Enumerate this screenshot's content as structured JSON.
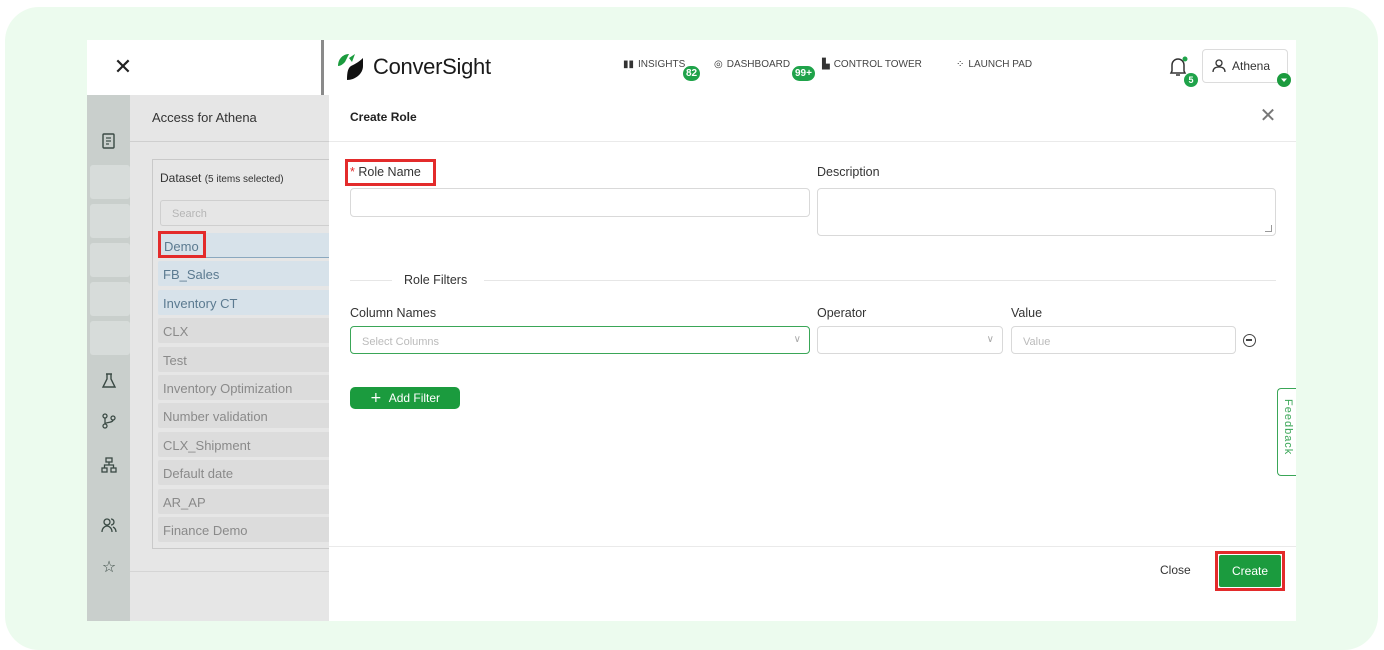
{
  "app": {
    "brand": "ConverSight",
    "brand_color": "#1b9b3e",
    "highlight_color": "#e32b2b"
  },
  "nav": {
    "items": [
      {
        "label": "INSIGHTS",
        "icon": "bar-chart-icon",
        "badge": "82"
      },
      {
        "label": "DASHBOARD",
        "icon": "dashboard-icon",
        "badge": "99+"
      },
      {
        "label": "CONTROL TOWER",
        "icon": "control-tower-icon",
        "badge": ""
      },
      {
        "label": "LAUNCH PAD",
        "icon": "launch-pad-icon",
        "badge": ""
      }
    ],
    "notifications_badge": "5",
    "user": "Athena"
  },
  "access_panel": {
    "title": "Access for Athena",
    "dataset_label": "Dataset",
    "dataset_count": "(5 items selected)",
    "search_placeholder": "Search",
    "datasets": [
      {
        "name": "Demo",
        "selected": true
      },
      {
        "name": "FB_Sales",
        "selected": true
      },
      {
        "name": "Inventory CT",
        "selected": true
      },
      {
        "name": "CLX",
        "selected": false
      },
      {
        "name": "Test",
        "selected": false
      },
      {
        "name": "Inventory Optimization",
        "selected": false
      },
      {
        "name": "Number validation",
        "selected": false
      },
      {
        "name": "CLX_Shipment",
        "selected": false
      },
      {
        "name": "Default date",
        "selected": false
      },
      {
        "name": "AR_AP",
        "selected": false
      },
      {
        "name": "Finance Demo",
        "selected": false
      }
    ]
  },
  "modal": {
    "title": "Create Role",
    "role_name_label": "Role Name",
    "required_mark": "*",
    "role_name_value": "",
    "description_label": "Description",
    "description_value": "",
    "role_filters_label": "Role Filters",
    "column_names_label": "Column Names",
    "column_placeholder": "Select Columns",
    "operator_label": "Operator",
    "operator_value": "",
    "value_label": "Value",
    "value_placeholder": "Value",
    "add_filter_label": "Add Filter",
    "close_label": "Close",
    "create_label": "Create"
  },
  "feedback_label": "Feedback"
}
